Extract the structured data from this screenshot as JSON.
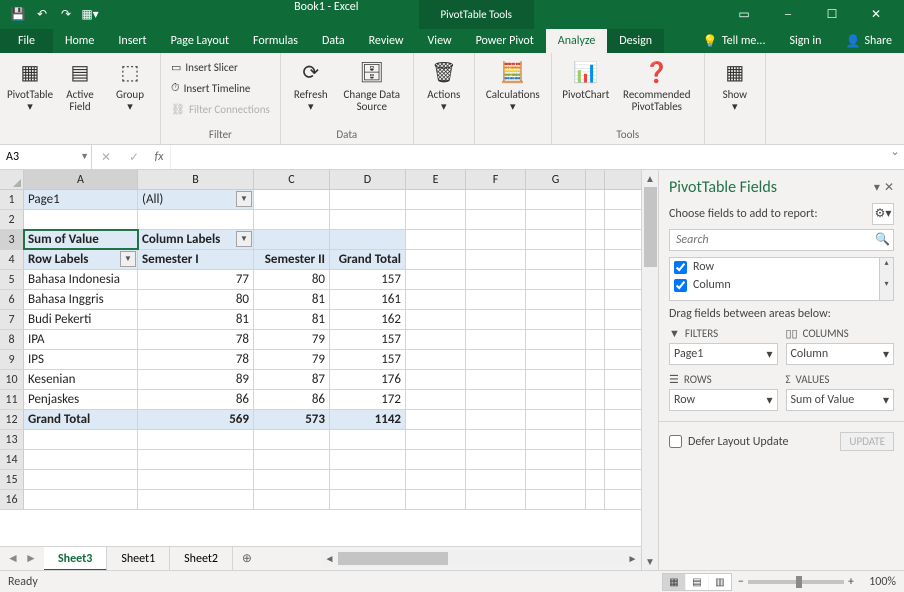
{
  "titlebar": {
    "doc_title": "Book1 - Excel",
    "tool_title": "PivotTable Tools"
  },
  "menu": {
    "file": "File",
    "tabs": [
      "Home",
      "Insert",
      "Page Layout",
      "Formulas",
      "Data",
      "Review",
      "View",
      "Power Pivot"
    ],
    "tool_tabs": [
      "Analyze",
      "Design"
    ],
    "active_tool_tab": "Analyze",
    "tellme": "Tell me...",
    "signin": "Sign in",
    "share": "Share"
  },
  "ribbon": {
    "pivottable": "PivotTable",
    "active_field": "Active\nField",
    "group": "Group",
    "insert_slicer": "Insert Slicer",
    "insert_timeline": "Insert Timeline",
    "filter_connections": "Filter Connections",
    "filter_label": "Filter",
    "refresh": "Refresh",
    "change_data_source": "Change Data\nSource",
    "data_label": "Data",
    "actions": "Actions",
    "calculations": "Calculations",
    "pivotchart": "PivotChart",
    "recommended": "Recommended\nPivotTables",
    "tools_label": "Tools",
    "show": "Show"
  },
  "namebox": "A3",
  "columns": [
    "A",
    "B",
    "C",
    "D",
    "E",
    "F",
    "G",
    ""
  ],
  "pivot": {
    "page_label": "Page1",
    "page_value": "(All)",
    "sum_label": "Sum of Value",
    "col_labels_hdr": "Column Labels",
    "row_labels_hdr": "Row Labels",
    "col_hdrs": [
      "Semester I",
      "Semester II",
      "Grand Total"
    ],
    "rows": [
      {
        "label": "Bahasa Indonesia",
        "s1": 77,
        "s2": 80,
        "gt": 157
      },
      {
        "label": "Bahasa Inggris",
        "s1": 80,
        "s2": 81,
        "gt": 161
      },
      {
        "label": "Budi Pekerti",
        "s1": 81,
        "s2": 81,
        "gt": 162
      },
      {
        "label": "IPA",
        "s1": 78,
        "s2": 79,
        "gt": 157
      },
      {
        "label": "IPS",
        "s1": 78,
        "s2": 79,
        "gt": 157
      },
      {
        "label": "Kesenian",
        "s1": 89,
        "s2": 87,
        "gt": 176
      },
      {
        "label": "Penjaskes",
        "s1": 86,
        "s2": 86,
        "gt": 172
      }
    ],
    "grand": {
      "label": "Grand Total",
      "s1": 569,
      "s2": 573,
      "gt": 1142
    }
  },
  "sheets": {
    "tabs": [
      "Sheet3",
      "Sheet1",
      "Sheet2"
    ],
    "active": "Sheet3"
  },
  "fieldpane": {
    "title": "PivotTable Fields",
    "subtitle": "Choose fields to add to report:",
    "search_ph": "Search",
    "fields": [
      "Row",
      "Column"
    ],
    "drag_label": "Drag fields between areas below:",
    "area_filters": "FILTERS",
    "area_columns": "COLUMNS",
    "area_rows": "ROWS",
    "area_values": "VALUES",
    "val_filters": "Page1",
    "val_columns": "Column",
    "val_rows": "Row",
    "val_values": "Sum of Value",
    "defer": "Defer Layout Update",
    "update": "UPDATE"
  },
  "status": {
    "ready": "Ready",
    "zoom": "100%"
  },
  "chart_data": {
    "type": "table",
    "title": "Sum of Value",
    "row_field": "Row",
    "column_field": "Column",
    "columns": [
      "Semester I",
      "Semester II"
    ],
    "rows": [
      {
        "label": "Bahasa Indonesia",
        "values": [
          77,
          80
        ]
      },
      {
        "label": "Bahasa Inggris",
        "values": [
          80,
          81
        ]
      },
      {
        "label": "Budi Pekerti",
        "values": [
          81,
          81
        ]
      },
      {
        "label": "IPA",
        "values": [
          78,
          79
        ]
      },
      {
        "label": "IPS",
        "values": [
          78,
          79
        ]
      },
      {
        "label": "Kesenian",
        "values": [
          89,
          87
        ]
      },
      {
        "label": "Penjaskes",
        "values": [
          86,
          86
        ]
      }
    ],
    "column_totals": [
      569,
      573
    ],
    "grand_total": 1142
  }
}
